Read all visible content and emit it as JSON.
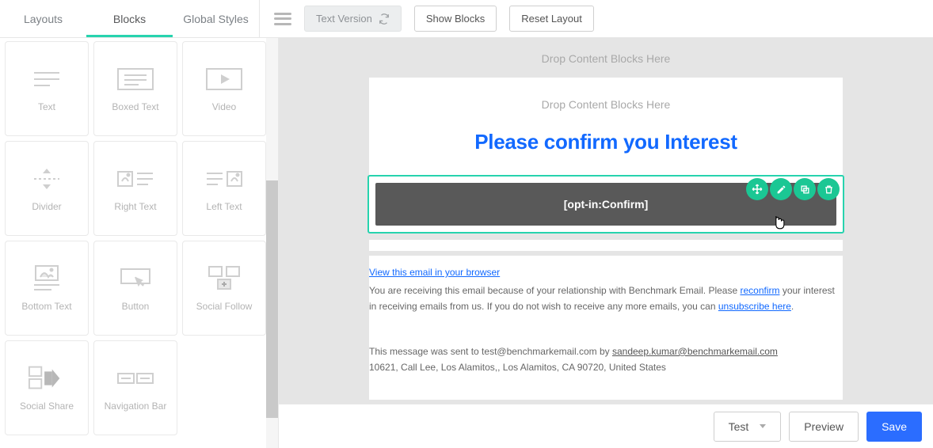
{
  "tabs": {
    "layouts": "Layouts",
    "blocks": "Blocks",
    "global": "Global Styles"
  },
  "toolbar": {
    "text_version": "Text Version",
    "show_blocks": "Show Blocks",
    "reset_layout": "Reset Layout"
  },
  "blocks": {
    "text": "Text",
    "boxed_text": "Boxed Text",
    "video": "Video",
    "divider": "Divider",
    "right_text": "Right Text",
    "left_text": "Left Text",
    "bottom_text": "Bottom Text",
    "button": "Button",
    "social_follow": "Social Follow",
    "social_share": "Social Share",
    "navigation_bar": "Navigation Bar"
  },
  "canvas": {
    "drop_hint": "Drop Content Blocks Here",
    "headline": "Please confirm you Interest",
    "button_block": "[opt-in:Confirm]"
  },
  "footer": {
    "view_browser": "View this email in your browser",
    "line1_a": "You are receiving this email because of your relationship with Benchmark Email. Please ",
    "reconfirm": "reconfirm",
    "line1_b": " your interest in receiving emails from us. If you do not wish to receive any more emails, you can ",
    "unsubscribe": "unsubscribe here",
    "line1_c": ".",
    "line2_a": "This message was sent to test@benchmarkemail.com by ",
    "sender": "sandeep.kumar@benchmarkemail.com",
    "address": "10621, Call Lee, Los Alamitos,, Los Alamitos, CA 90720, United States"
  },
  "bottombar": {
    "test": "Test",
    "preview": "Preview",
    "save": "Save"
  },
  "colors": {
    "accent_green": "#27d3ae",
    "primary_blue": "#2b6dff",
    "link_blue": "#1269ff"
  }
}
